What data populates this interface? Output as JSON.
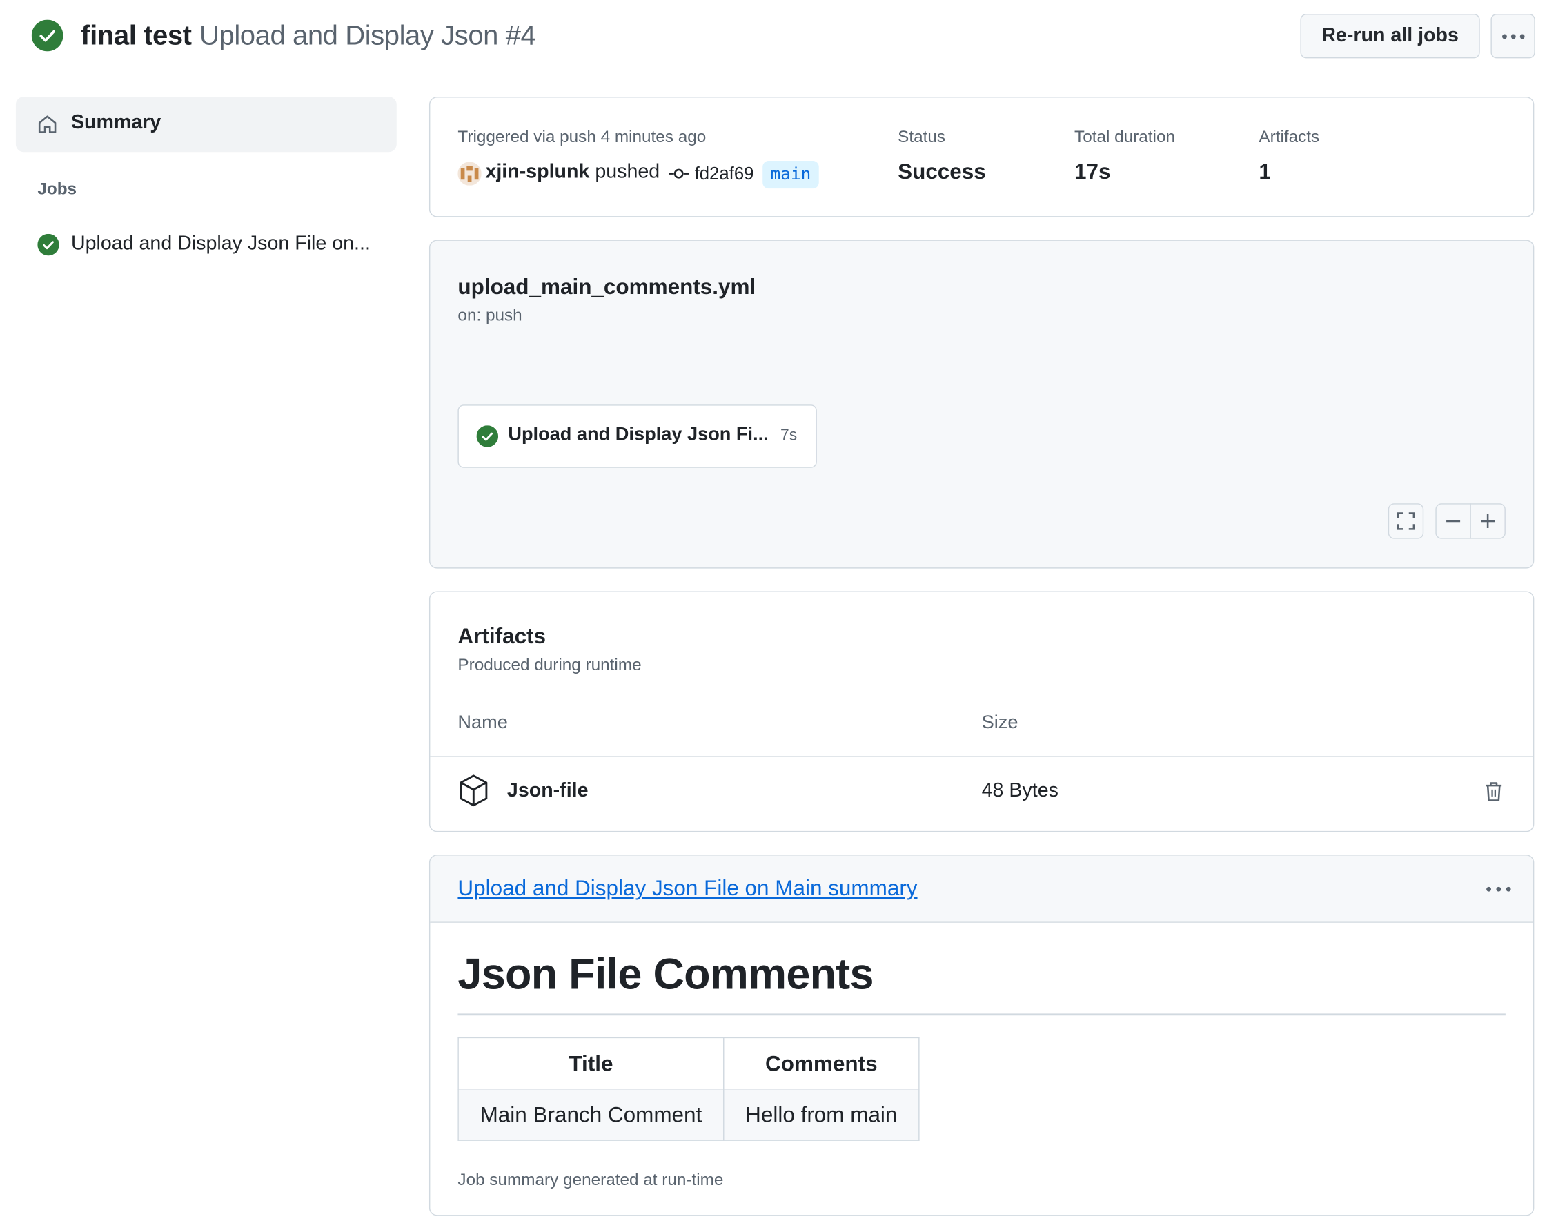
{
  "colors": {
    "success": "#1a7f37",
    "link": "#0969da",
    "muted_text": "#59636e",
    "border": "#d1d9e0",
    "branch_bg": "#ddf4ff"
  },
  "header": {
    "workflow_name": "final test",
    "run_name": "Upload and Display Json #4",
    "status_icon": "check-circle-fill-icon",
    "rerun_label": "Re-run all jobs",
    "more_icon": "kebab-horizontal-icon"
  },
  "sidebar": {
    "summary_label": "Summary",
    "summary_icon": "home-icon",
    "jobs_heading": "Jobs",
    "jobs": [
      {
        "label": "Upload and Display Json File on...",
        "status_icon": "check-circle-fill-icon"
      }
    ]
  },
  "run_info": {
    "trigger": "Triggered via push 4 minutes ago",
    "actor": "xjin-splunk",
    "action": "pushed",
    "commit_icon": "git-commit-icon",
    "commit_sha": "fd2af69",
    "branch": "main",
    "status_label": "Status",
    "status_value": "Success",
    "duration_label": "Total duration",
    "duration_value": "17s",
    "artifacts_label": "Artifacts",
    "artifacts_value": "1"
  },
  "workflow_graph": {
    "file": "upload_main_comments.yml",
    "event": "on: push",
    "job": {
      "label": "Upload and Display Json Fi...",
      "duration": "7s",
      "status_icon": "check-circle-fill-icon"
    },
    "controls": [
      "screen-full-icon",
      "dash-icon",
      "plus-icon"
    ]
  },
  "artifacts": {
    "title": "Artifacts",
    "subtitle": "Produced during runtime",
    "columns": [
      "Name",
      "Size"
    ],
    "rows": [
      {
        "name": "Json-file",
        "size": "48 Bytes",
        "icon": "package-icon",
        "action_icon": "trash-icon"
      }
    ]
  },
  "job_summary": {
    "link": "Upload and Display Json File on Main summary",
    "heading": "Json File Comments",
    "table": {
      "headers": [
        "Title",
        "Comments"
      ],
      "rows": [
        [
          "Main Branch Comment",
          "Hello from main"
        ]
      ]
    },
    "footer": "Job summary generated at run-time"
  }
}
